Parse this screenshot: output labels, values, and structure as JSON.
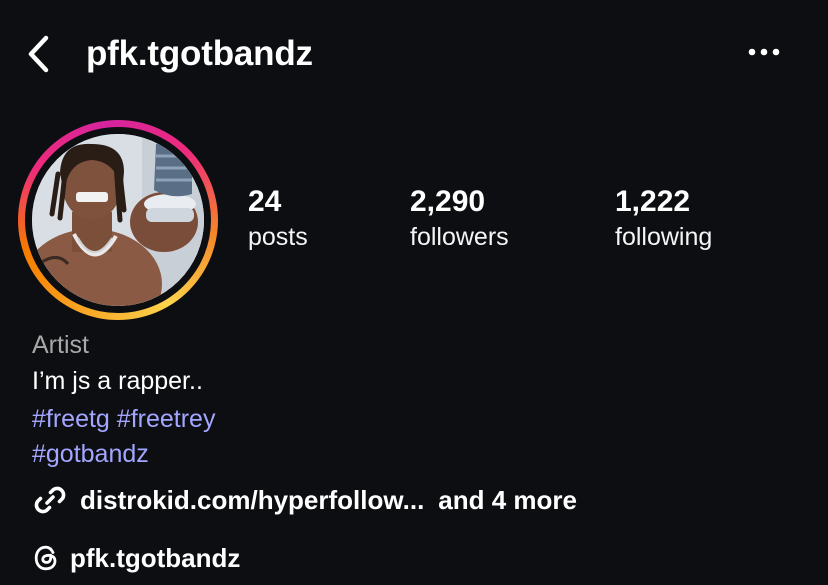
{
  "header": {
    "back_icon": "chevron-left-icon",
    "username": "pfk.tgotbandz",
    "more_icon": "more-horizontal-icon"
  },
  "profile": {
    "avatar_description_icon": "profile-avatar",
    "story_ring_colors": [
      "#f9a825",
      "#ee2a7b",
      "#d6249f"
    ],
    "stats": [
      {
        "value": "24",
        "label": "posts"
      },
      {
        "value": "2,290",
        "label": "followers"
      },
      {
        "value": "1,222",
        "label": "following"
      }
    ],
    "category": "Artist",
    "bio": "I’m js a rapper..",
    "hashtags": [
      "#freetg",
      "#freetrey",
      "#gotbandz"
    ],
    "link": {
      "icon": "link-icon",
      "text": "distrokid.com/hyperfollow...",
      "more": "and 4 more"
    },
    "threads": {
      "icon": "threads-icon",
      "handle": "pfk.tgotbandz"
    }
  },
  "colors": {
    "background": "#0c0e12",
    "hashtag": "#a3a6ff",
    "category": "#a8a8a8"
  }
}
